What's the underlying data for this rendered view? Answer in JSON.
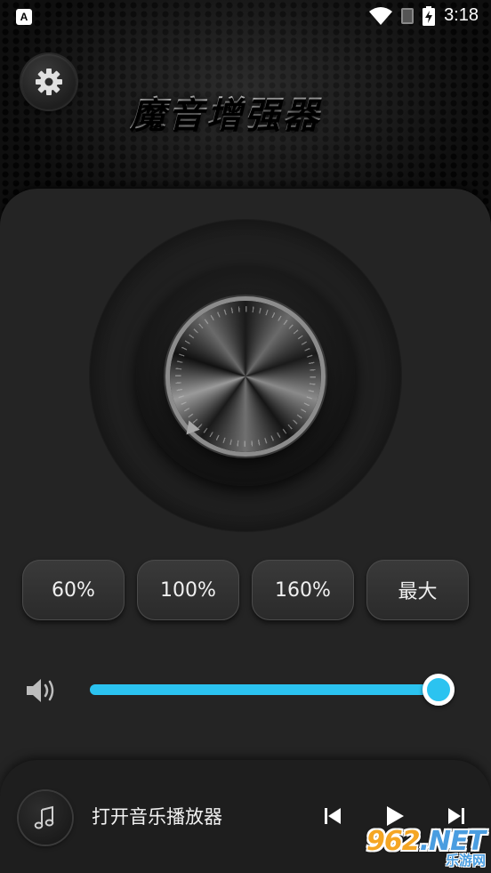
{
  "status_bar": {
    "notification_badge": "A",
    "time": "3:18",
    "icons": [
      "wifi-icon",
      "sim-icon",
      "battery-charging-icon"
    ]
  },
  "header": {
    "title": "魔音增强器",
    "settings_icon": "gear-icon"
  },
  "knob": {
    "icon": "volume-knob"
  },
  "presets": [
    {
      "label": "60%"
    },
    {
      "label": "100%"
    },
    {
      "label": "160%"
    },
    {
      "label": "最大"
    }
  ],
  "volume": {
    "icon": "speaker-icon",
    "level": 0.98,
    "accent_color": "#2bc3f0"
  },
  "player": {
    "label": "打开音乐播放器",
    "icon": "music-note-icon",
    "controls": [
      "previous-icon",
      "play-icon",
      "next-icon"
    ]
  },
  "watermark": {
    "main": "962",
    "suffix": ".NET",
    "sub": "乐游网"
  }
}
